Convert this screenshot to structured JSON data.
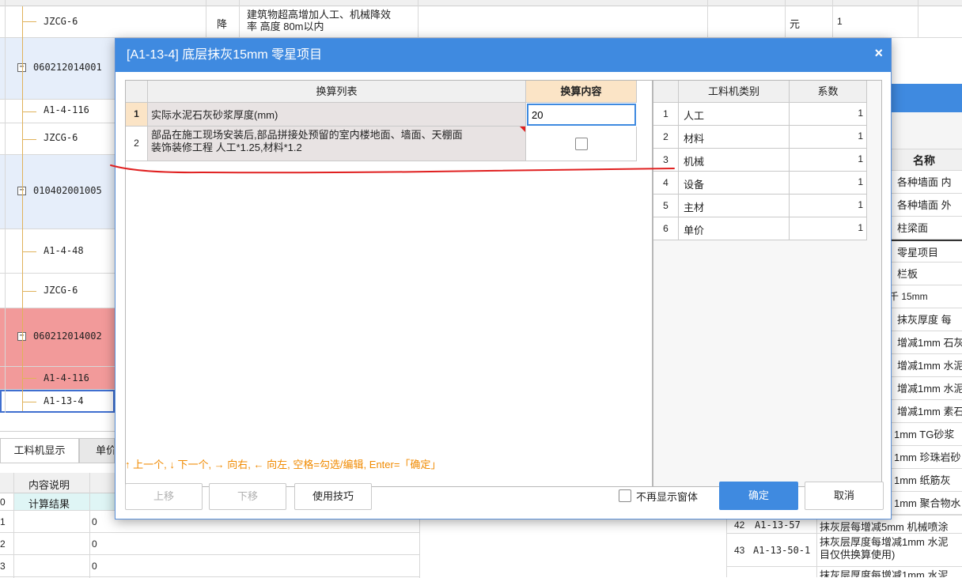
{
  "background_tree": {
    "rows": [
      {
        "code": "JZCG-6",
        "type": "降",
        "desc_line1": "建筑物超高增加人工、机械降效",
        "desc_line2": "率 高度 80m以内",
        "unit": "元",
        "qty": "1"
      },
      {
        "code": "060212014001",
        "toggle": "−"
      },
      {
        "code": "A1-4-116"
      },
      {
        "code": "JZCG-6"
      },
      {
        "code": "010402001005",
        "toggle": "−"
      },
      {
        "code": "A1-4-48"
      },
      {
        "code": "JZCG-6"
      },
      {
        "code": "060212014002",
        "toggle": "−"
      },
      {
        "code": "A1-4-116"
      },
      {
        "code": "A1-13-4"
      }
    ]
  },
  "right_table": {
    "header": "名称",
    "rows": [
      "各种墙面 内",
      "各种墙面 外",
      "柱梁面",
      "零星项目",
      "栏板",
      "千 15mm",
      "抹灰厚度 每",
      "增减1mm 石灰",
      "增减1mm 水泥",
      "增减1mm 水泥",
      "增减1mm 素石",
      "1mm TG砂浆",
      "1mm 珍珠岩砂",
      "1mm 纸筋灰",
      "1mm 聚合物水"
    ],
    "extra_rows": [
      {
        "num": "42",
        "code": "A1-13-57",
        "name": "抹灰层每增减5mm 机械喷涂"
      },
      {
        "num": "43",
        "code": "A1-13-50-1",
        "name_line1": "抹灰层厚度每增减1mm 水泥",
        "name_line2": "目仅供换算使用)"
      },
      {
        "num": "",
        "code": "",
        "name": "抹灰层厚度每增减1mm 水泥"
      }
    ]
  },
  "bottom_panel": {
    "tabs": [
      "工料机显示",
      "单价"
    ],
    "col_header": "内容说明",
    "rows": [
      {
        "num": "0",
        "label": "计算结果",
        "value": ""
      },
      {
        "num": "1",
        "label": "",
        "value": "0"
      },
      {
        "num": "2",
        "label": "",
        "value": "0"
      },
      {
        "num": "3",
        "label": "",
        "value": "0"
      }
    ]
  },
  "dialog": {
    "title": "[A1-13-4] 底层抹灰15mm 零星项目",
    "close": "×",
    "left_grid": {
      "col_list": "换算列表",
      "col_content": "换算内容",
      "rows": [
        {
          "num": "1",
          "text": "实际水泥石灰砂浆厚度(mm)",
          "value": "20"
        },
        {
          "num": "2",
          "text_line1": "部品在施工现场安装后,部品拼接处预留的室内楼地面、墙面、天棚面",
          "text_line2": "装饰装修工程 人工*1.25,材料*1.2",
          "checked": false
        }
      ]
    },
    "right_grid": {
      "col_type": "工料机类别",
      "col_coef": "系数",
      "rows": [
        {
          "num": "1",
          "type": "人工",
          "coef": "1"
        },
        {
          "num": "2",
          "type": "材料",
          "coef": "1"
        },
        {
          "num": "3",
          "type": "机械",
          "coef": "1"
        },
        {
          "num": "4",
          "type": "设备",
          "coef": "1"
        },
        {
          "num": "5",
          "type": "主材",
          "coef": "1"
        },
        {
          "num": "6",
          "type": "单价",
          "coef": "1"
        }
      ]
    },
    "hint": "↑ 上一个, ↓ 下一个, → 向右, ← 向左, 空格=勾选/编辑, Enter=「确定」",
    "buttons": {
      "up": "上移",
      "down": "下移",
      "tips": "使用技巧",
      "no_show": "不再显示窗体",
      "ok": "确定",
      "cancel": "取消"
    },
    "colors": {
      "title_bg": "#3f8ae0",
      "hint": "#f08a00",
      "annotation": "#e02020"
    }
  }
}
